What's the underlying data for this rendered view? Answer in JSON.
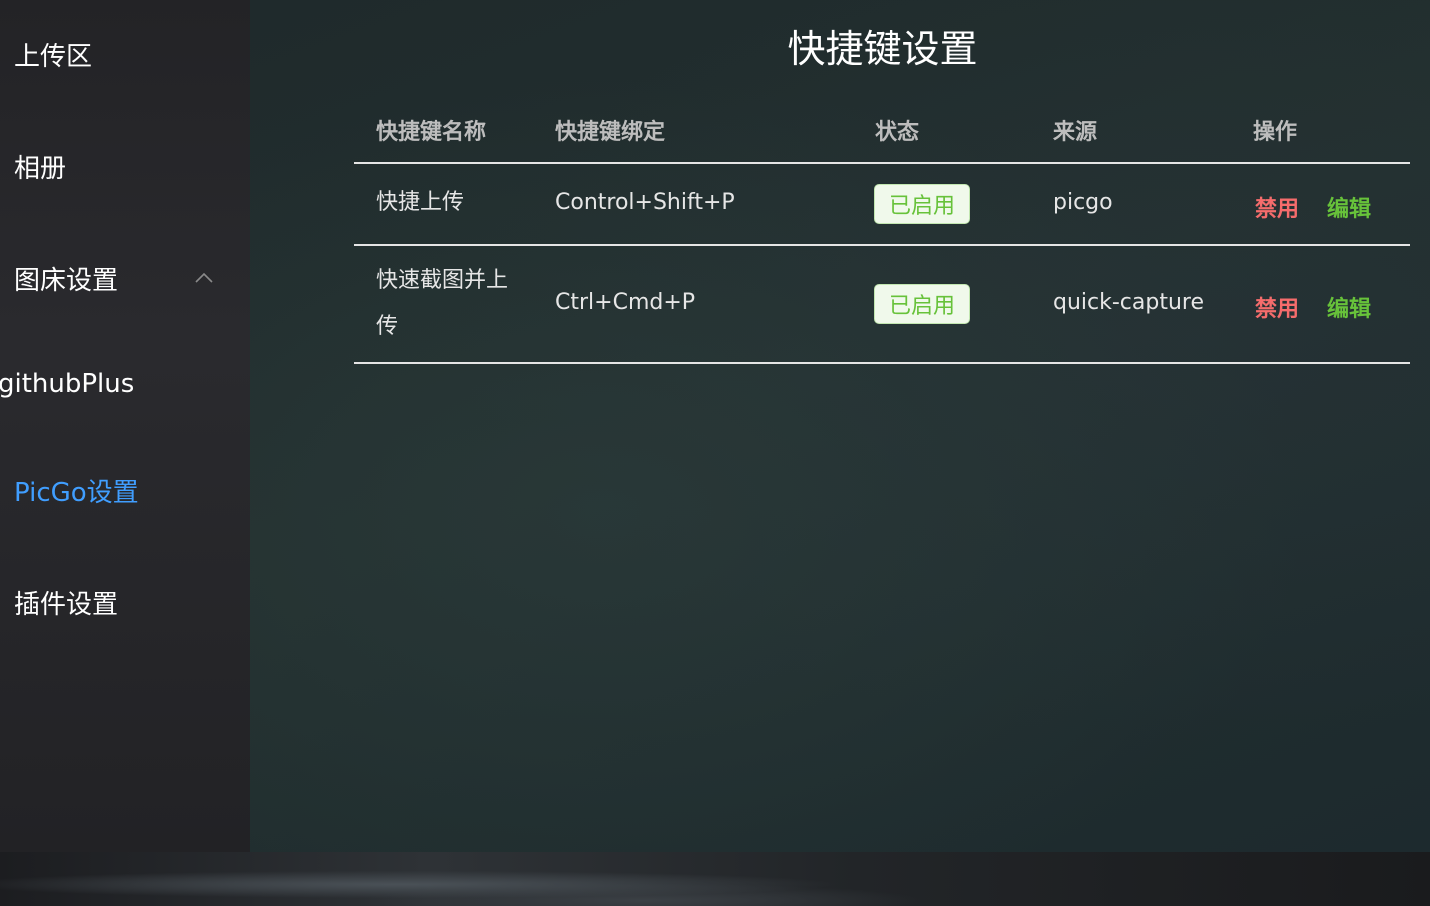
{
  "sidebar": {
    "items": [
      {
        "label": "上传区"
      },
      {
        "label": "相册"
      },
      {
        "label": "图床设置"
      },
      {
        "label": "githubPlus"
      },
      {
        "label": "PicGo设置"
      },
      {
        "label": "插件设置"
      }
    ],
    "active_item": "PicGo设置",
    "accent_color": "#409eff"
  },
  "main": {
    "title": "快捷键设置",
    "table": {
      "columns": [
        "快捷键名称",
        "快捷键绑定",
        "状态",
        "来源",
        "操作"
      ],
      "rows": [
        {
          "name": "快捷上传",
          "binding": "Control+Shift+P",
          "status": "已启用",
          "source": "picgo",
          "actions": {
            "disable": "禁用",
            "edit": "编辑"
          }
        },
        {
          "name": "快速截图并上传",
          "binding": "Ctrl+Cmd+P",
          "status": "已启用",
          "source": "quick-capture",
          "actions": {
            "disable": "禁用",
            "edit": "编辑"
          }
        }
      ]
    }
  },
  "colors": {
    "status_tag": "#67c23a",
    "disable_action": "#f56c6c",
    "edit_action": "#67c23a"
  },
  "icons": {
    "submenu_toggle": "chevron-up-icon"
  }
}
